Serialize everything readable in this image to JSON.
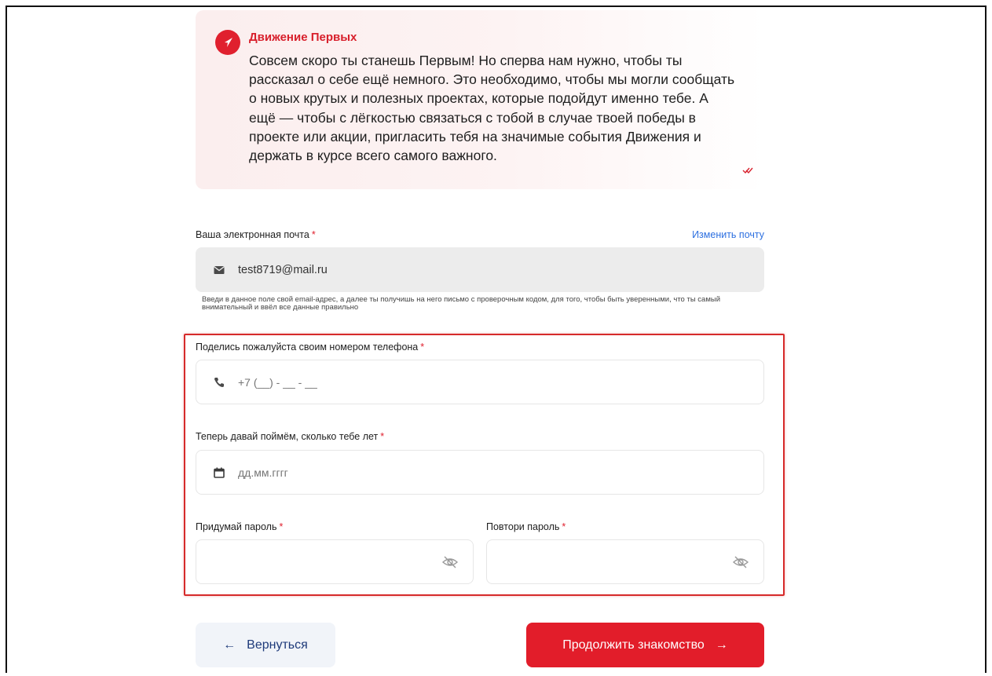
{
  "message": {
    "author": "Движение Первых",
    "text": "Совсем скоро ты станешь Первым! Но сперва нам нужно, чтобы ты рассказал о себе ещё немного. Это необходимо, чтобы мы могли сообщать о новых крутых и полезных проектах, которые подойдут именно тебе. А ещё — чтобы с лёгкостью связаться с тобой в случае твоей победы в проекте или акции, пригласить тебя на значимые события Движения и держать в курсе всего самого важного."
  },
  "email": {
    "label": "Ваша электронная почта",
    "required_mark": "*",
    "change_link": "Изменить почту",
    "value": "test8719@mail.ru",
    "hint": "Введи в данное поле свой email-адрес, а далее ты получишь на него письмо с проверочным кодом, для того, чтобы быть уверенными, что ты самый внимательный и ввёл все данные правильно"
  },
  "phone": {
    "label": "Поделись пожалуйста своим номером телефона",
    "required_mark": "*",
    "placeholder": "+7 (__) - __ - __"
  },
  "birthdate": {
    "label": "Теперь давай поймём, сколько тебе лет",
    "required_mark": "*",
    "placeholder": "дд.мм.гггг"
  },
  "password": {
    "label": "Придумай пароль",
    "required_mark": "*"
  },
  "password_repeat": {
    "label": "Повтори пароль",
    "required_mark": "*"
  },
  "buttons": {
    "back_label": "Вернуться",
    "back_arrow": "←",
    "next_label": "Продолжить знакомство",
    "next_arrow": "→"
  },
  "colors": {
    "accent": "#e21d2a",
    "link": "#2c6fe0",
    "highlight": "#d62a2a"
  }
}
